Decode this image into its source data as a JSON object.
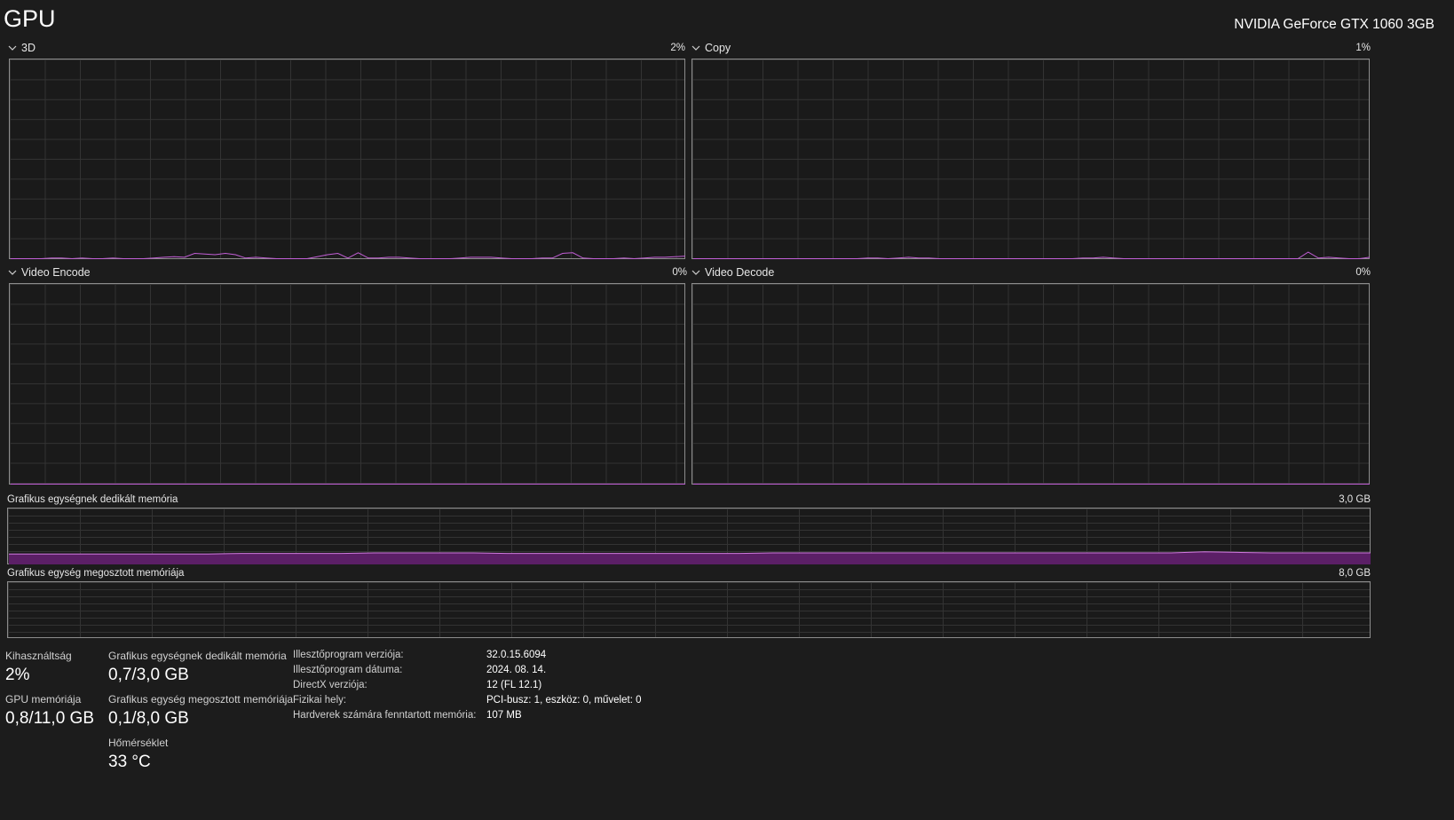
{
  "header": {
    "title": "GPU",
    "gpu_name": "NVIDIA GeForce GTX 1060 3GB"
  },
  "engines": [
    {
      "label": "3D",
      "percent": "2%",
      "usage": [
        0,
        0,
        0,
        0,
        0.3,
        0.3,
        0,
        0.3,
        0,
        0,
        0.3,
        0,
        0,
        0,
        0.3,
        0.7,
        1,
        0.7,
        2.7,
        2.3,
        2,
        2.7,
        2,
        0.3,
        0.7,
        0.3,
        0,
        0,
        0,
        0,
        1,
        2,
        2.7,
        0.3,
        3,
        0.3,
        0.3,
        0.7,
        0.7,
        0.3,
        0,
        0,
        0,
        0,
        0.3,
        0.7,
        0.7,
        0.7,
        0.3,
        0,
        0,
        0,
        0.3,
        0.3,
        2.7,
        3,
        0.3,
        0,
        0,
        0,
        0.3,
        0,
        0.3,
        0.7,
        0.7,
        1,
        1.3
      ]
    },
    {
      "label": "Copy",
      "percent": "1%",
      "usage": [
        0,
        0,
        0,
        0,
        0,
        0,
        0,
        0,
        0,
        0,
        0,
        0,
        0,
        0,
        0,
        0,
        0,
        0.3,
        0.3,
        0,
        0.3,
        0.7,
        0.3,
        0.3,
        0,
        0,
        0,
        0,
        0,
        0,
        0,
        0,
        0,
        0,
        0,
        0,
        0,
        0,
        0.3,
        0.3,
        0.7,
        0.3,
        0,
        0,
        0,
        0,
        0,
        0,
        0,
        0,
        0,
        0,
        0,
        0,
        0,
        0,
        0,
        0,
        0,
        0,
        3.3,
        0.3,
        0.7,
        0.3,
        0,
        0,
        0.7
      ]
    },
    {
      "label": "Video Encode",
      "percent": "0%",
      "usage": [
        0,
        0,
        0,
        0,
        0,
        0,
        0,
        0,
        0,
        0,
        0,
        0,
        0,
        0,
        0,
        0,
        0,
        0,
        0,
        0,
        0,
        0,
        0,
        0,
        0,
        0,
        0,
        0,
        0,
        0,
        0,
        0,
        0,
        0,
        0,
        0,
        0,
        0,
        0,
        0,
        0,
        0,
        0,
        0,
        0,
        0,
        0,
        0,
        0,
        0,
        0,
        0,
        0,
        0,
        0,
        0,
        0,
        0,
        0,
        0,
        0,
        0,
        0,
        0,
        0,
        0,
        0
      ]
    },
    {
      "label": "Video Decode",
      "percent": "0%",
      "usage": [
        0,
        0,
        0,
        0,
        0,
        0,
        0,
        0,
        0,
        0,
        0,
        0,
        0,
        0,
        0,
        0,
        0,
        0,
        0,
        0,
        0,
        0,
        0,
        0,
        0,
        0,
        0,
        0,
        0,
        0,
        0,
        0,
        0,
        0,
        0,
        0,
        0,
        0,
        0,
        0,
        0,
        0,
        0,
        0,
        0,
        0,
        0,
        0,
        0,
        0,
        0,
        0,
        0,
        0,
        0,
        0,
        0,
        0,
        0,
        0,
        0,
        0,
        0,
        0,
        0,
        0,
        0
      ]
    }
  ],
  "memory_graphs": [
    {
      "label": "Grafikus egységnek dedikált memória",
      "max": "3,0 GB",
      "usage_fraction": [
        0.19,
        0.19,
        0.19,
        0.19,
        0.19,
        0.19,
        0.19,
        0.2,
        0.2,
        0.2,
        0.2,
        0.21,
        0.21,
        0.21,
        0.21,
        0.2,
        0.2,
        0.2,
        0.2,
        0.2,
        0.2,
        0.2,
        0.2,
        0.21,
        0.21,
        0.21,
        0.21,
        0.21,
        0.21,
        0.21,
        0.21,
        0.21,
        0.21,
        0.21,
        0.21,
        0.21,
        0.23,
        0.22,
        0.21,
        0.21,
        0.21,
        0.21
      ]
    },
    {
      "label": "Grafikus egység megosztott memóriája",
      "max": "8,0 GB",
      "usage_fraction": [
        0,
        0,
        0,
        0,
        0,
        0,
        0,
        0,
        0,
        0,
        0,
        0,
        0,
        0,
        0,
        0,
        0,
        0,
        0,
        0
      ]
    }
  ],
  "stats": {
    "utilization_label": "Kihasználtság",
    "utilization_value": "2%",
    "gpu_memory_label": "GPU memóriája",
    "gpu_memory_value": "0,8/11,0 GB",
    "dedicated_label": "Grafikus egységnek dedikált memória",
    "dedicated_value": "0,7/3,0 GB",
    "shared_label": "Grafikus egység megosztott memóriája",
    "shared_value": "0,1/8,0 GB",
    "temp_label": "Hőmérséklet",
    "temp_value": "33 °C"
  },
  "info": [
    {
      "key": "Illesztőprogram verziója:",
      "value": "32.0.15.6094"
    },
    {
      "key": "Illesztőprogram dátuma:",
      "value": "2024. 08. 14."
    },
    {
      "key": "DirectX verziója:",
      "value": "12 (FL 12.1)"
    },
    {
      "key": "Fizikai hely:",
      "value": "PCI-busz: 1, eszköz: 0, művelet: 0"
    },
    {
      "key": "Hardverek számára fenntartott memória:",
      "value": "107 MB"
    }
  ],
  "colors": {
    "line": "#c25ed6",
    "fill": "#5b1f66",
    "mem_line": "#d17ae0"
  }
}
